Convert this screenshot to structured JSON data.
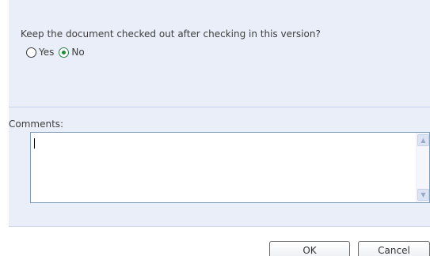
{
  "checkout": {
    "question": "Keep the document checked out after checking in this version?",
    "options": [
      {
        "label": "Yes",
        "selected": false
      },
      {
        "label": "No",
        "selected": true
      }
    ]
  },
  "comments": {
    "label": "Comments:",
    "value": ""
  },
  "buttons": {
    "ok_label": "OK",
    "cancel_label": "Cancel"
  },
  "colors": {
    "panel_bg": "#e9eef9",
    "radio_selected": "#1c8a3a",
    "textarea_border": "#7f9db9"
  }
}
